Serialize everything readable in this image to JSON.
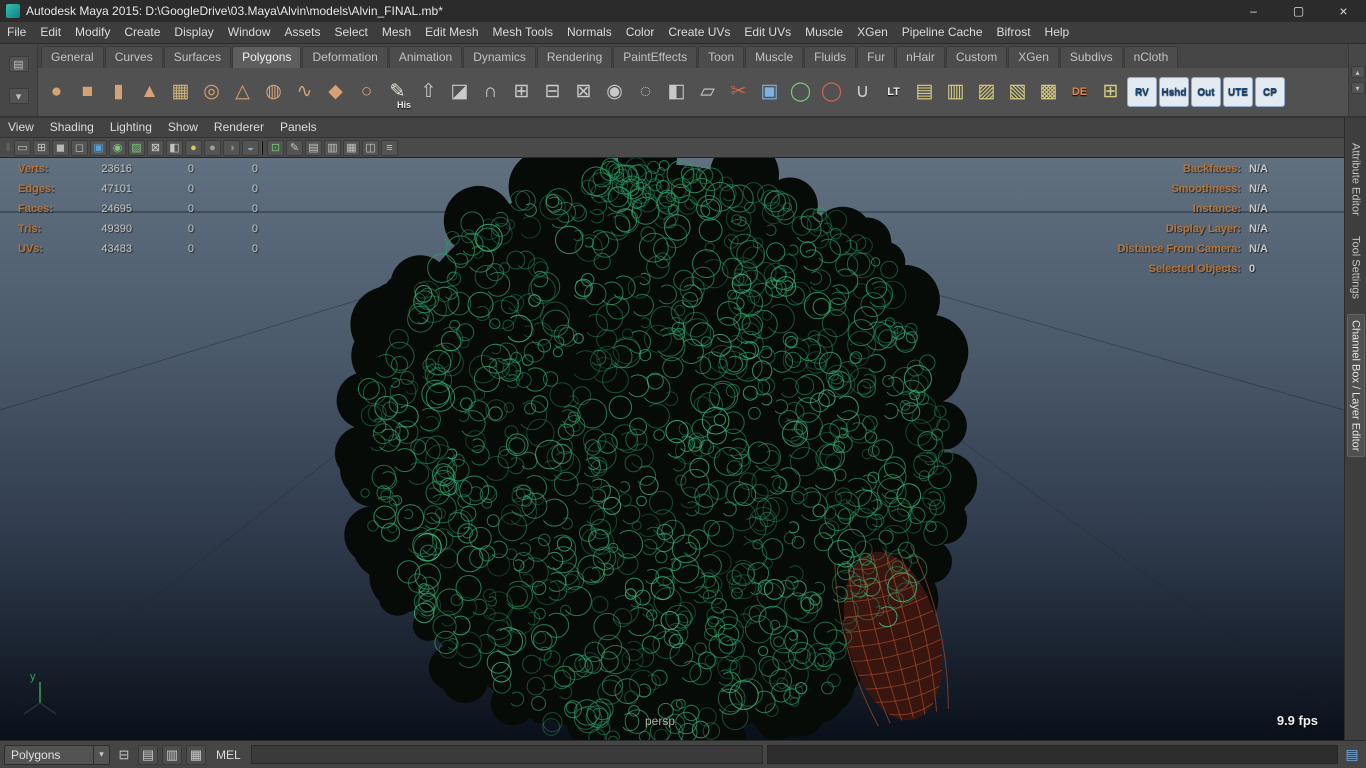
{
  "window": {
    "title": "Autodesk Maya 2015: D:\\GoogleDrive\\03.Maya\\Alvin\\models\\Alvin_FINAL.mb*",
    "controls": {
      "minimize": "–",
      "maximize": "▢",
      "close": "×"
    }
  },
  "menubar": {
    "items": [
      {
        "label": "File"
      },
      {
        "label": "Edit"
      },
      {
        "label": "Modify"
      },
      {
        "label": "Create"
      },
      {
        "label": "Display"
      },
      {
        "label": "Window"
      },
      {
        "label": "Assets"
      },
      {
        "label": "Select"
      },
      {
        "label": "Mesh"
      },
      {
        "label": "Edit Mesh"
      },
      {
        "label": "Mesh Tools"
      },
      {
        "label": "Normals"
      },
      {
        "label": "Color"
      },
      {
        "label": "Create UVs"
      },
      {
        "label": "Edit UVs"
      },
      {
        "label": "Muscle"
      },
      {
        "label": "XGen"
      },
      {
        "label": "Pipeline Cache"
      },
      {
        "label": "Bifrost"
      },
      {
        "label": "Help"
      }
    ]
  },
  "shelf": {
    "left_buttons": [
      {
        "name": "shelf-tab-list-icon",
        "glyph": "▤"
      },
      {
        "name": "shelf-collapse-icon",
        "glyph": "▾"
      }
    ],
    "scroll_buttons": [
      {
        "name": "shelf-scroll-up-icon",
        "glyph": "▴"
      },
      {
        "name": "shelf-scroll-down-icon",
        "glyph": "▾"
      }
    ],
    "tabs": [
      {
        "label": "General"
      },
      {
        "label": "Curves"
      },
      {
        "label": "Surfaces"
      },
      {
        "label": "Polygons",
        "active": true
      },
      {
        "label": "Deformation"
      },
      {
        "label": "Animation"
      },
      {
        "label": "Dynamics"
      },
      {
        "label": "Rendering"
      },
      {
        "label": "PaintEffects"
      },
      {
        "label": "Toon"
      },
      {
        "label": "Muscle"
      },
      {
        "label": "Fluids"
      },
      {
        "label": "Fur"
      },
      {
        "label": "nHair"
      },
      {
        "label": "Custom"
      },
      {
        "label": "XGen"
      },
      {
        "label": "Subdivs"
      },
      {
        "label": "nCloth"
      }
    ],
    "icons": [
      {
        "name": "poly-sphere-icon",
        "glyph": "●",
        "color": "#d4a273"
      },
      {
        "name": "poly-cube-icon",
        "glyph": "■",
        "color": "#d4a273"
      },
      {
        "name": "poly-cylinder-icon",
        "glyph": "▮",
        "color": "#d4a273"
      },
      {
        "name": "poly-cone-icon",
        "glyph": "▲",
        "color": "#d4a273"
      },
      {
        "name": "poly-plane-icon",
        "glyph": "▦",
        "color": "#cdb37e"
      },
      {
        "name": "poly-torus-icon",
        "glyph": "◎",
        "color": "#d4a273"
      },
      {
        "name": "poly-pyramid-icon",
        "glyph": "△",
        "color": "#d4a273"
      },
      {
        "name": "poly-pipe-icon",
        "glyph": "◍",
        "color": "#d4a273"
      },
      {
        "name": "poly-helix-icon",
        "glyph": "∿",
        "color": "#d4a273"
      },
      {
        "name": "poly-platonic-icon",
        "glyph": "◆",
        "color": "#d4a273"
      },
      {
        "name": "poly-soccerball-icon",
        "glyph": "○",
        "color": "#d4a273"
      },
      {
        "name": "modeling-history-icon",
        "glyph": "✎",
        "color": "#e6e2d8",
        "label": "His"
      },
      {
        "name": "poly-extrude-icon",
        "glyph": "⇧",
        "color": "#c9c9c9"
      },
      {
        "name": "poly-bevel-icon",
        "glyph": "◪",
        "color": "#c9c9c9"
      },
      {
        "name": "poly-bridge-icon",
        "glyph": "∩",
        "color": "#c9c9c9"
      },
      {
        "name": "poly-combine-icon",
        "glyph": "⊞",
        "color": "#c9c9c9"
      },
      {
        "name": "poly-separate-icon",
        "glyph": "⊟",
        "color": "#c9c9c9"
      },
      {
        "name": "poly-boolean-icon",
        "glyph": "⊠",
        "color": "#c9c9c9"
      },
      {
        "name": "poly-smooth-icon",
        "glyph": "◉",
        "color": "#c9c9c9"
      },
      {
        "name": "poly-reduce-icon",
        "glyph": "◌",
        "color": "#c9c9c9"
      },
      {
        "name": "poly-mirror-icon",
        "glyph": "◧",
        "color": "#c9c9c9"
      },
      {
        "name": "quad-draw-icon",
        "glyph": "▱",
        "color": "#c9c9c9"
      },
      {
        "name": "multi-cut-icon",
        "glyph": "✂",
        "color": "#d2654f"
      },
      {
        "name": "target-weld-icon",
        "glyph": "▣",
        "color": "#7fb2e0"
      },
      {
        "name": "symmetry-on-icon",
        "glyph": "◯",
        "color": "#7bc97b"
      },
      {
        "name": "symmetry-off-icon",
        "glyph": "◯",
        "color": "#d2654f"
      },
      {
        "name": "snap-magnet-icon",
        "glyph": "∪",
        "color": "#c9c9c9"
      },
      {
        "name": "lt-icon",
        "label": "LT",
        "cls": "textonly",
        "lcolor": "#ececec"
      },
      {
        "name": "uv-planar-icon",
        "glyph": "▤",
        "color": "#d8cd7d"
      },
      {
        "name": "uv-automatic-icon",
        "glyph": "▥",
        "color": "#d8cd7d"
      },
      {
        "name": "uv-cylindrical-icon",
        "glyph": "▨",
        "color": "#d8cd7d"
      },
      {
        "name": "uv-spherical-icon",
        "glyph": "▧",
        "color": "#d8cd7d"
      },
      {
        "name": "uv-contour-stretch-icon",
        "glyph": "▩",
        "color": "#d8cd7d"
      },
      {
        "name": "de-icon",
        "label": "DE",
        "cls": "textonly",
        "lcolor": "#e0893c"
      },
      {
        "name": "uv-editor-grid-icon",
        "glyph": "⊞",
        "color": "#d8cd7d"
      },
      {
        "name": "render-view-icon",
        "label": "RV",
        "cls": "render"
      },
      {
        "name": "hypershade-icon",
        "label": "Hshd",
        "cls": "render"
      },
      {
        "name": "outliner-icon",
        "label": "Out",
        "cls": "render"
      },
      {
        "name": "uv-texture-editor-icon",
        "label": "UTE",
        "cls": "render"
      },
      {
        "name": "component-editor-icon",
        "label": "CP",
        "cls": "render"
      }
    ]
  },
  "panel": {
    "menu": [
      {
        "label": "View"
      },
      {
        "label": "Shading"
      },
      {
        "label": "Lighting"
      },
      {
        "label": "Show"
      },
      {
        "label": "Renderer"
      },
      {
        "label": "Panels"
      }
    ],
    "toolbar_icons": [
      {
        "name": "toolbar-grip",
        "glyph": "‖",
        "cls": "grip"
      },
      {
        "name": "single-pane-layout-icon",
        "glyph": "▭",
        "color": "#c4c4c4"
      },
      {
        "name": "four-pane-layout-icon",
        "glyph": "⊞",
        "color": "#c4c4c4"
      },
      {
        "name": "shaded-mode-icon",
        "glyph": "◼",
        "color": "#b8b8b8"
      },
      {
        "name": "xray-mode-icon",
        "glyph": "◻",
        "color": "#c4c4c4"
      },
      {
        "name": "wireframe-on-shaded-icon",
        "glyph": "▣",
        "color": "#5aa0d8"
      },
      {
        "name": "default-material-icon",
        "glyph": "◉",
        "color": "#79c879"
      },
      {
        "name": "textured-mode-icon",
        "glyph": "▨",
        "color": "#79c879"
      },
      {
        "name": "checker-map-icon",
        "glyph": "⊠",
        "color": "#d0d0d0"
      },
      {
        "name": "highlight-selection-icon",
        "glyph": "◧",
        "color": "#c4c4c4"
      },
      {
        "name": "use-all-lights-icon",
        "glyph": "●",
        "color": "#d8c85a"
      },
      {
        "name": "two-sided-lighting-icon",
        "glyph": "●",
        "color": "#a0a0a0"
      },
      {
        "name": "shadows-icon",
        "glyph": "◑",
        "color": "#909090"
      },
      {
        "name": "occlusion-icon",
        "glyph": "◒",
        "color": "#8fa8b8"
      },
      {
        "name": "toolbar-separator",
        "cls": "sep"
      },
      {
        "name": "isolate-select-icon",
        "glyph": "⊡",
        "color": "#79c879"
      },
      {
        "name": "grease-pencil-icon",
        "glyph": "✎",
        "color": "#c4c4c4"
      },
      {
        "name": "camera-attributes-icon",
        "glyph": "▤",
        "color": "#c4c4c4"
      },
      {
        "name": "bookmarks-icon",
        "glyph": "▥",
        "color": "#c4c4c4"
      },
      {
        "name": "image-plane-icon",
        "glyph": "▦",
        "color": "#c4c4c4"
      },
      {
        "name": "multi-component-icon",
        "glyph": "◫",
        "color": "#c4c4c4"
      },
      {
        "name": "panel-menu-icon",
        "glyph": "≡",
        "color": "#c4c4c4"
      }
    ]
  },
  "hud": {
    "left_rows": [
      {
        "label": "Verts:",
        "c1": "23616",
        "c2": "0",
        "c3": "0"
      },
      {
        "label": "Edges:",
        "c1": "47101",
        "c2": "0",
        "c3": "0"
      },
      {
        "label": "Faces:",
        "c1": "24695",
        "c2": "0",
        "c3": "0"
      },
      {
        "label": "Tris:",
        "c1": "49390",
        "c2": "0",
        "c3": "0"
      },
      {
        "label": "UVs:",
        "c1": "43483",
        "c2": "0",
        "c3": "0"
      }
    ],
    "right_rows": [
      {
        "label": "Backfaces:",
        "value": "N/A"
      },
      {
        "label": "Smoothness:",
        "value": "N/A"
      },
      {
        "label": "Instance:",
        "value": "N/A"
      },
      {
        "label": "Display Layer:",
        "value": "N/A"
      },
      {
        "label": "Distance From Camera:",
        "value": "N/A"
      },
      {
        "label": "Selected Objects:",
        "value": "0"
      }
    ],
    "label_color": "#b5763b",
    "value_color": "#c6c6c6"
  },
  "viewport": {
    "camera_label": "persp",
    "fps": "9.9 fps",
    "axis_label": "y",
    "wireframe_color": "#2ba468",
    "background_top": "#61707f",
    "background_bottom": "#0a101a"
  },
  "right_panel_tabs": [
    {
      "label": "Attribute Editor"
    },
    {
      "label": "Tool Settings"
    },
    {
      "label": "Channel Box / Layer Editor",
      "active": true
    }
  ],
  "statusbar": {
    "menu_set": "Polygons",
    "menu_arrow": "▾",
    "icons": [
      {
        "name": "quick-layout-icon",
        "glyph": "⊟",
        "cls": "plain"
      },
      {
        "name": "outliner-toggle-icon",
        "glyph": "▤"
      },
      {
        "name": "graph-layout-icon",
        "glyph": "▥"
      },
      {
        "name": "hypergraph-toggle-icon",
        "glyph": "▦"
      }
    ],
    "mel_label": "MEL",
    "command_value": "",
    "script_editor_glyph": "▤"
  }
}
